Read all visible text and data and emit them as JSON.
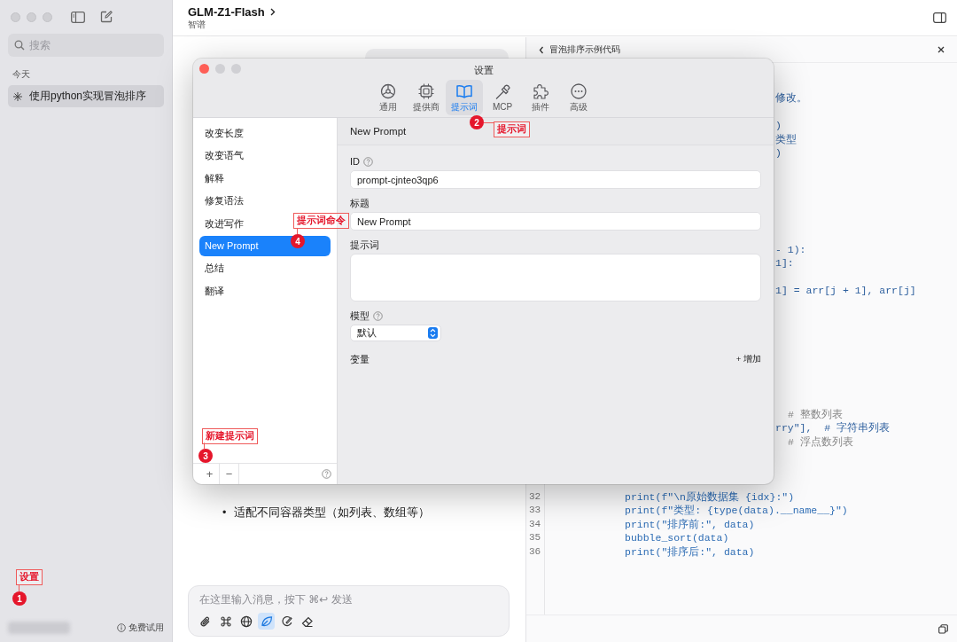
{
  "sidebar": {
    "search": {
      "placeholder": "搜索"
    },
    "section": "今天",
    "conversations": [
      {
        "title": "使用python实现冒泡排序",
        "selected": true
      }
    ],
    "trial": "免费试用"
  },
  "chat": {
    "model": "GLM-Z1-Flash",
    "provider": "智谱",
    "bullets": [
      {
        "marker": "•",
        "text": "适配不同容器类型（如列表、数组等）"
      }
    ],
    "composer": {
      "placeholder": "在这里输入消息，按下 ⌘↩ 发送",
      "tools": [
        {
          "kind": "attach",
          "selected": false
        },
        {
          "kind": "command",
          "selected": false
        },
        {
          "kind": "web",
          "selected": false
        },
        {
          "kind": "leaf",
          "selected": true
        },
        {
          "kind": "brush",
          "selected": false
        },
        {
          "kind": "eraser",
          "selected": false
        }
      ]
    }
  },
  "artifact": {
    "title": "冒泡排序示例代码",
    "blocks": [
      [
        {
          "kind": "clipped",
          "text": "修改。"
        }
      ],
      [
        {
          "kind": "clipped",
          "text": ")"
        },
        {
          "kind": "clipped",
          "text": "类型"
        },
        {
          "kind": "clipped",
          "text": ")"
        }
      ],
      [
        {
          "kind": "clipped",
          "text": "- 1):"
        },
        {
          "kind": "clipped",
          "text": "1]:"
        }
      ],
      [
        {
          "kind": "clipped",
          "text": "1] = arr[j + 1], arr[j]"
        }
      ],
      [
        {
          "kind": "comment",
          "text": "# 整数列表"
        },
        {
          "kind": "clipped",
          "text": "rry\"],  # 字符串列表"
        },
        {
          "kind": "comment",
          "text": "# 浮点数列表"
        }
      ],
      [
        {
          "kind": "line",
          "number": "32",
          "text": "print(f\"\\n原始数据集 {idx}:\")"
        },
        {
          "kind": "line",
          "number": "33",
          "text": "print(f\"类型: {type(data).__name__}\")"
        },
        {
          "kind": "line",
          "number": "34",
          "text": "print(\"排序前:\", data)"
        },
        {
          "kind": "line",
          "number": "35",
          "text": "bubble_sort(data)"
        },
        {
          "kind": "line",
          "number": "36",
          "text": "print(\"排序后:\", data)"
        }
      ]
    ]
  },
  "settings": {
    "title": "设置",
    "tabs": [
      {
        "label": "通用",
        "kind": "general",
        "selected": false
      },
      {
        "label": "提供商",
        "kind": "providers",
        "selected": false
      },
      {
        "label": "提示词",
        "kind": "prompts",
        "selected": true
      },
      {
        "label": "MCP",
        "kind": "mcp",
        "selected": false
      },
      {
        "label": "插件",
        "kind": "plugins",
        "selected": false
      },
      {
        "label": "高级",
        "kind": "advanced",
        "selected": false
      }
    ],
    "prompts": [
      {
        "label": "改变长度",
        "selected": false
      },
      {
        "label": "改变语气",
        "selected": false
      },
      {
        "label": "解释",
        "selected": false
      },
      {
        "label": "修复语法",
        "selected": false
      },
      {
        "label": "改进写作",
        "selected": false
      },
      {
        "label": "New Prompt",
        "selected": true
      },
      {
        "label": "总结",
        "selected": false
      },
      {
        "label": "翻译",
        "selected": false
      }
    ],
    "add": "+",
    "remove": "−",
    "editor": {
      "heading": "New Prompt",
      "fields": [
        {
          "kind": "text",
          "label": "ID",
          "help": true,
          "value": "prompt-cjnteo3qp6"
        },
        {
          "kind": "text",
          "label": "标题",
          "help": false,
          "value": "New Prompt"
        },
        {
          "kind": "textarea",
          "label": "提示词",
          "help": false
        },
        {
          "kind": "select",
          "label": "模型",
          "help": true,
          "value": "默认"
        }
      ],
      "variables": {
        "label": "变量",
        "add": "+ 增加"
      }
    }
  },
  "annotations": [
    {
      "number": "1",
      "label": "设置"
    },
    {
      "number": "2",
      "label": "提示词"
    },
    {
      "number": "3",
      "label": "新建提示词"
    },
    {
      "number": "4",
      "label": "提示词命令"
    }
  ]
}
